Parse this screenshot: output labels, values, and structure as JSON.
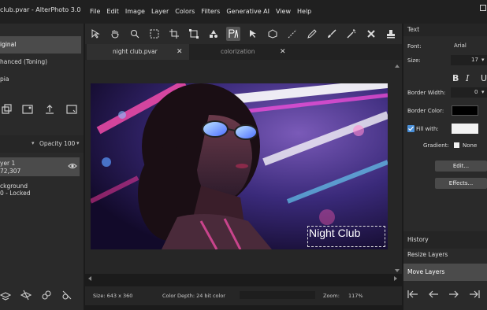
{
  "window": {
    "title": "club.pvar - AlterPhoto 3.0"
  },
  "menu": [
    "File",
    "Edit",
    "Image",
    "Layer",
    "Colors",
    "Filters",
    "Generative AI",
    "View",
    "Help"
  ],
  "history": [
    {
      "label": "iginal",
      "selected": true
    },
    {
      "label": "hanced (Toning)",
      "selected": false
    },
    {
      "label": "pia",
      "selected": false
    }
  ],
  "layers_panel": {
    "opacity_label": "Opacity",
    "opacity_value": "100",
    "layers": [
      {
        "name": "yer 1",
        "info": "72,307",
        "selected": true
      },
      {
        "name": "ckground",
        "info": "0 - Locked",
        "selected": false
      }
    ]
  },
  "tabs": [
    {
      "label": "night club.pvar",
      "active": true
    },
    {
      "label": "colorization",
      "active": false
    }
  ],
  "canvas": {
    "text_layer": "Night Club"
  },
  "status": {
    "size": "Size: 643 x 360",
    "depth": "Color Depth: 24 bit color",
    "zoom_label": "Zoom:",
    "zoom_value": "117%"
  },
  "text_panel": {
    "title": "Text",
    "font_label": "Font:",
    "font_value": "Arial",
    "size_label": "Size:",
    "size_value": "17",
    "bold": "B",
    "italic": "I",
    "underline": "U",
    "border_width_label": "Border Width:",
    "border_width_value": "0",
    "border_color_label": "Border Color:",
    "border_color": "#000000",
    "fill_label": "Fill with:",
    "fill_checked": true,
    "fill_color": "#f2f2f2",
    "gradient_label": "Gradient:",
    "gradient_value": "None",
    "edit_button": "Edit...",
    "effects_button": "Effects..."
  },
  "right_list": [
    {
      "label": "History",
      "selected": false
    },
    {
      "label": "Resize Layers",
      "selected": false
    },
    {
      "label": "Move Layers",
      "selected": true
    }
  ],
  "colors": {
    "accent": "#4a90d9",
    "panel": "#2a2a2a",
    "selected": "#4b4b4b"
  }
}
